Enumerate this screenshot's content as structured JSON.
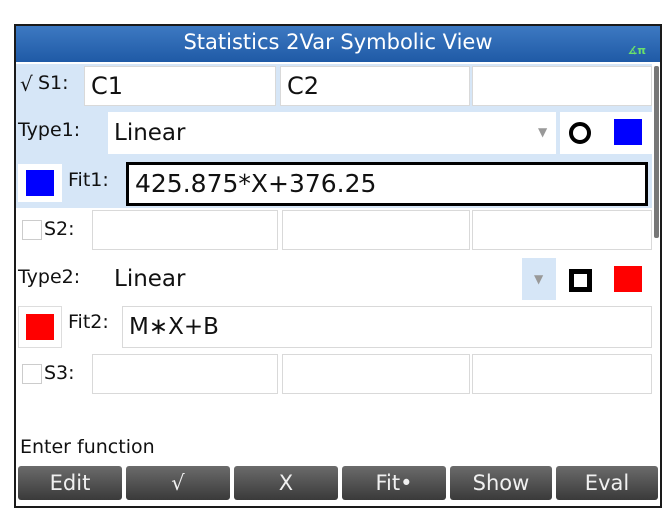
{
  "title": "Statistics 2Var Symbolic View",
  "angle_indicator": "∡π",
  "s1": {
    "check": "√",
    "label": "S1:",
    "col1": "C1",
    "col2": "C2",
    "col3": ""
  },
  "type1": {
    "label": "Type1:",
    "value": "Linear",
    "dropdown": "▼"
  },
  "fit1": {
    "label": "Fit1:",
    "value": "425.875*X+376.25",
    "color": "#0000ff"
  },
  "s2": {
    "label": "S2:",
    "col1": "",
    "col2": "",
    "col3": ""
  },
  "type2": {
    "label": "Type2:",
    "value": "Linear",
    "dropdown": "▼"
  },
  "fit2": {
    "label": "Fit2:",
    "value": "M∗X+B",
    "color": "#ff0000"
  },
  "s3": {
    "label": "S3:",
    "col1": "",
    "col2": "",
    "col3": ""
  },
  "prompt": "Enter function",
  "menu": [
    "Edit",
    "√",
    "X",
    "Fit•",
    "Show",
    "Eval"
  ],
  "colors": {
    "blue": "#0000ff",
    "red": "#ff0000",
    "title": "#2563ae",
    "highlight": "#d6e6f7"
  }
}
